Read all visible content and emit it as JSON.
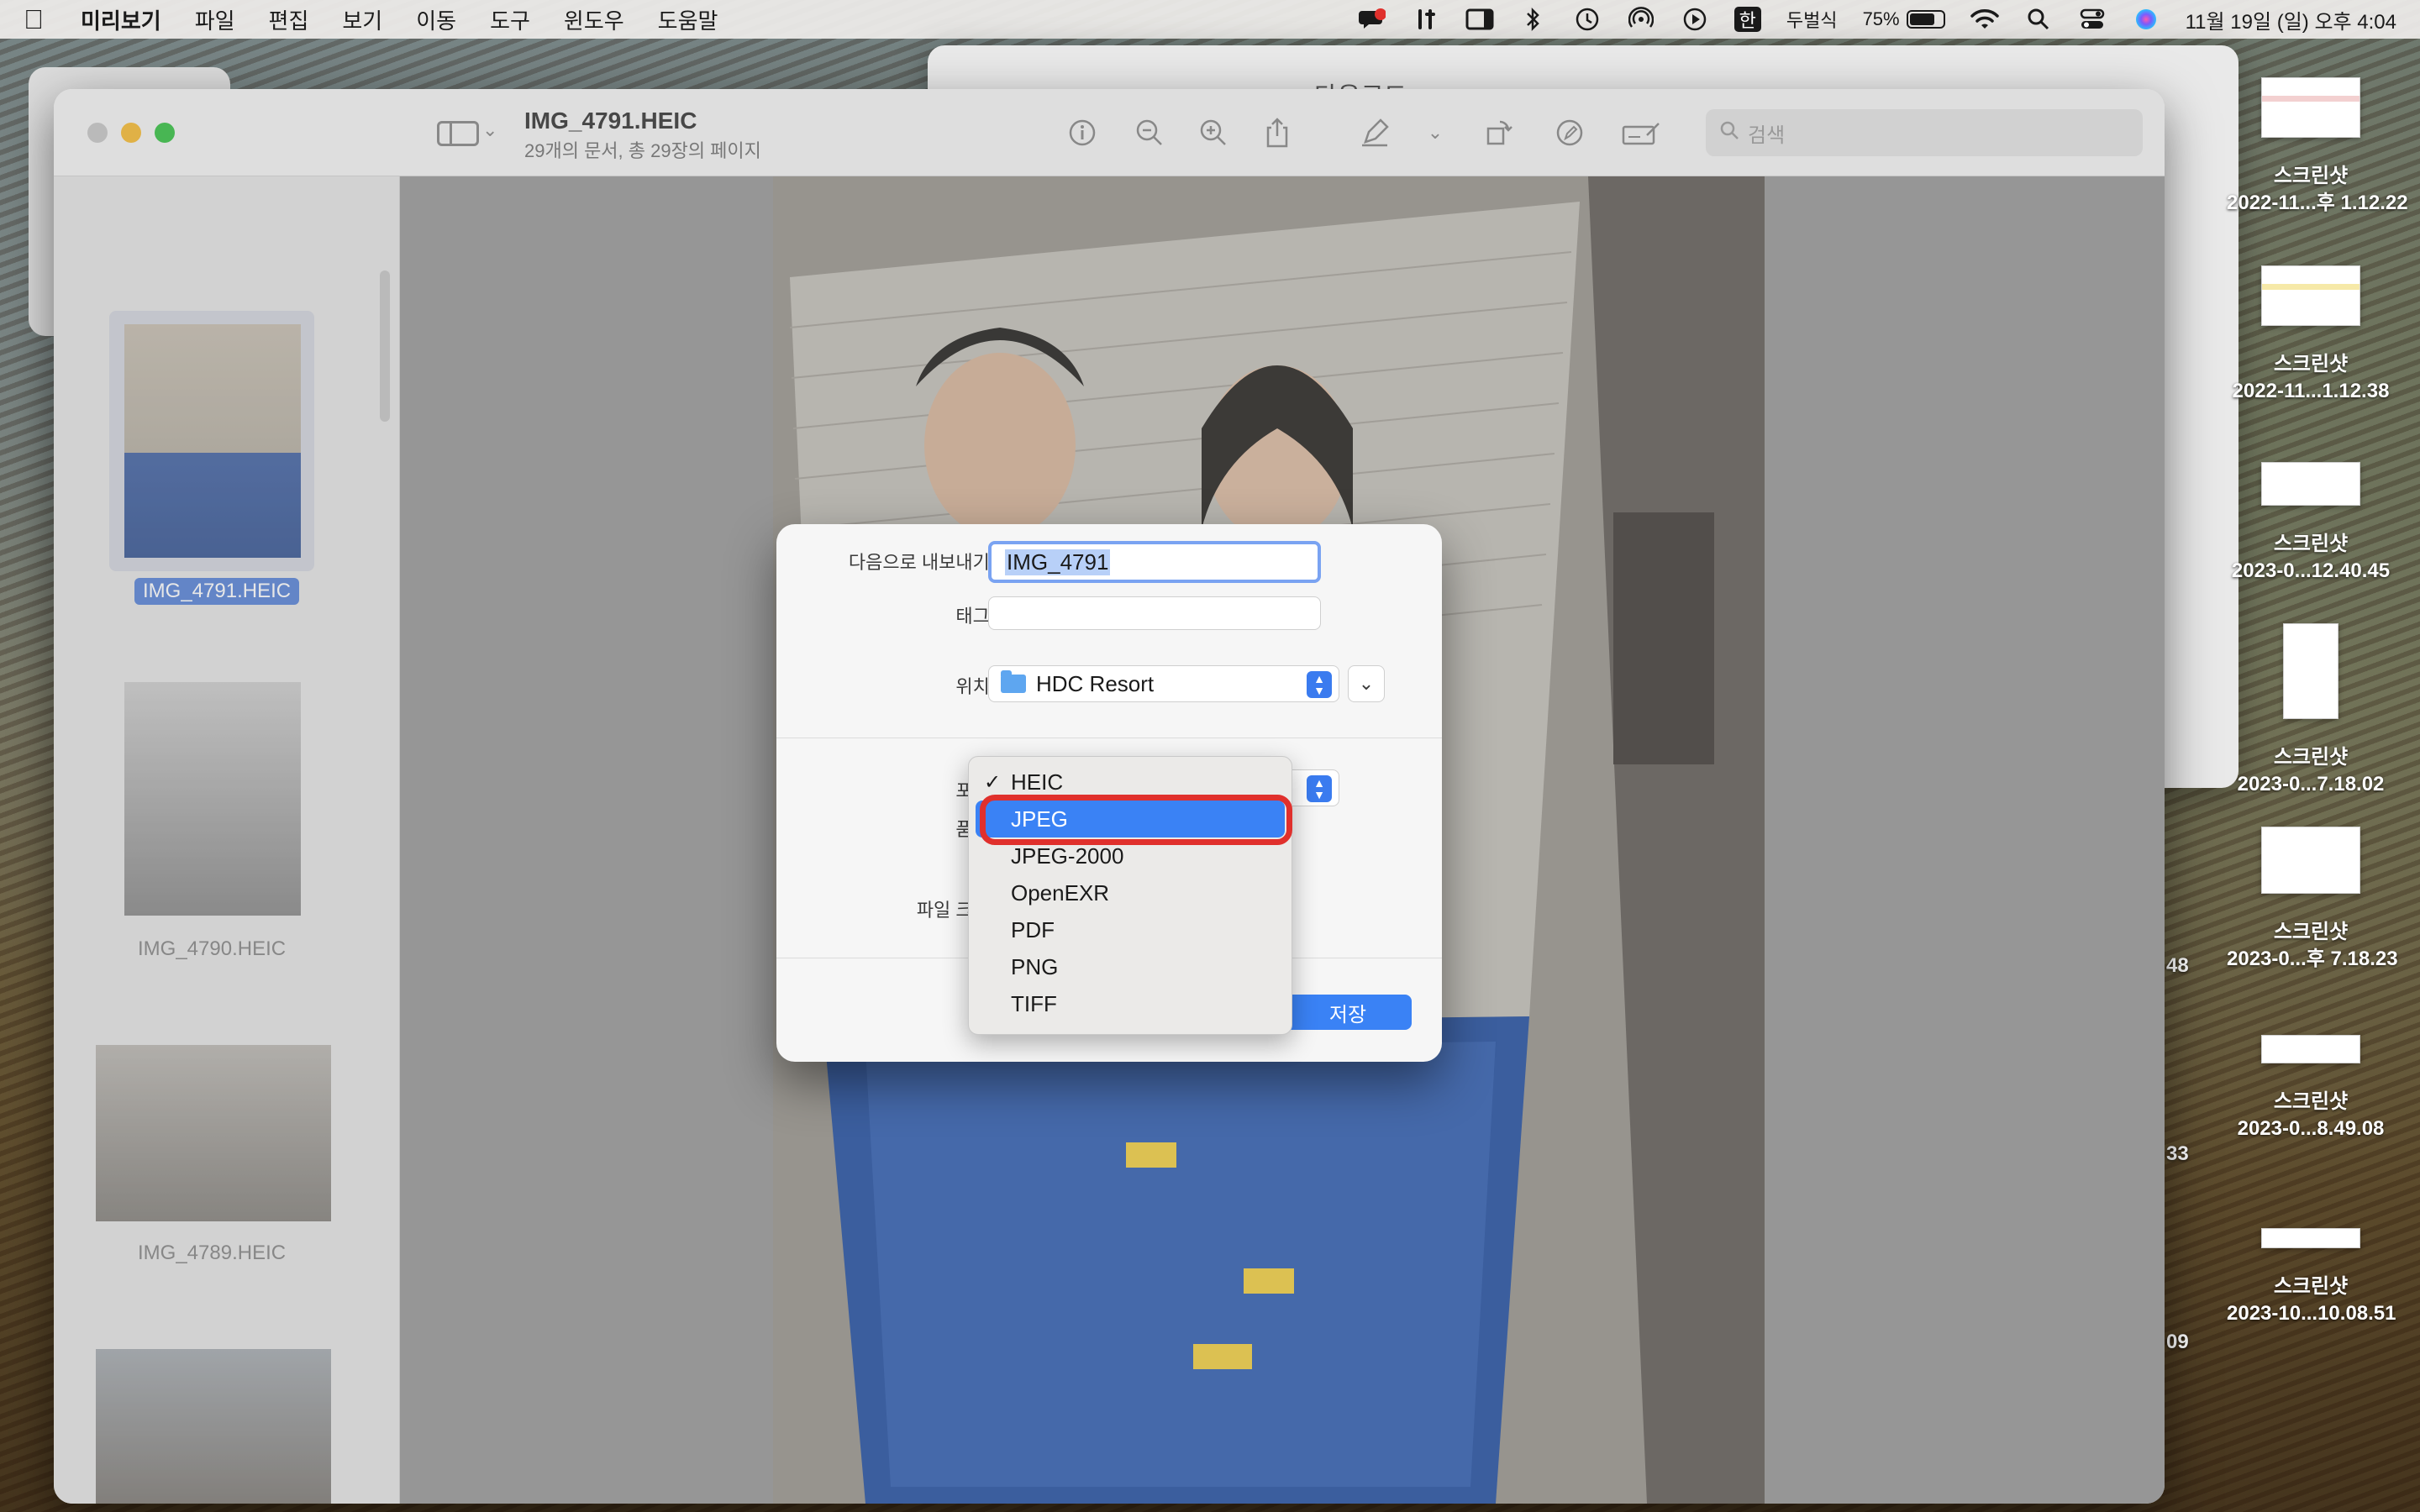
{
  "menubar": {
    "app_name": "미리보기",
    "items": [
      "파일",
      "편집",
      "보기",
      "이동",
      "도구",
      "윈도우",
      "도움말"
    ],
    "ime_label": "한",
    "input_source": "두벌식",
    "battery_percent": "75%",
    "battery_level": 0.75,
    "datetime": "11월 19일 (일) 오후 4:04"
  },
  "bg_window": {
    "title": "다운로드"
  },
  "preview": {
    "title": "IMG_4791.HEIC",
    "subtitle": "29개의 문서, 총 29장의 페이지",
    "search_placeholder": "검색",
    "thumbnails": [
      {
        "label": "IMG_4791.HEIC",
        "selected": true
      },
      {
        "label": "IMG_4790.HEIC",
        "selected": false
      },
      {
        "label": "IMG_4789.HEIC",
        "selected": false
      },
      {
        "label": "",
        "selected": false
      }
    ]
  },
  "export_sheet": {
    "export_as_label": "다음으로 내보내기:",
    "filename": "IMG_4791",
    "tags_label": "태그:",
    "location_label": "위치:",
    "location_value": "HDC Resort",
    "format_label": "포맷:",
    "quality_label": "품질:",
    "filesize_label": "파일 크기:",
    "save_button": "저장"
  },
  "format_menu": {
    "options": [
      "HEIC",
      "JPEG",
      "JPEG-2000",
      "OpenEXR",
      "PDF",
      "PNG",
      "TIFF"
    ],
    "checked": "HEIC",
    "highlighted": "JPEG"
  },
  "desktop_icons": [
    {
      "title": "스크린샷",
      "subtitle": "2022-11...후 1.12.22"
    },
    {
      "title": "스크린샷",
      "subtitle": "2022-11...1.12.38"
    },
    {
      "title": "스크린샷",
      "subtitle": "2023-0...12.40.45"
    },
    {
      "title": "스크린샷",
      "subtitle": "2023-0...7.18.02"
    },
    {
      "title": "스크린샷",
      "subtitle": "2023-0...후 7.18.23"
    },
    {
      "title": "스크린샷",
      "subtitle": "2023-0...8.49.08"
    },
    {
      "title": "스크린샷",
      "subtitle": "2023-10...10.08.51"
    }
  ],
  "desktop_partial_labels": [
    "48",
    "33",
    "09"
  ],
  "colors": {
    "accent": "#3a82f5",
    "highlight_ring": "#e0302c",
    "selection": "#5f88d8"
  }
}
